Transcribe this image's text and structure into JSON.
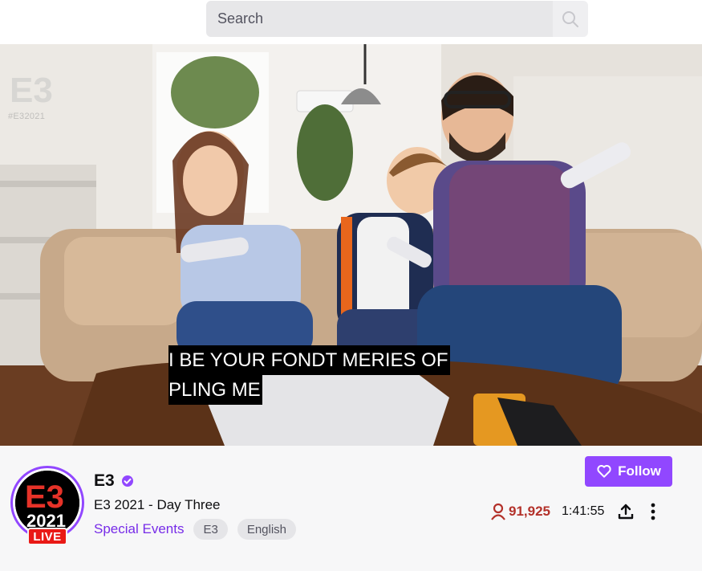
{
  "search": {
    "placeholder": "Search"
  },
  "video": {
    "watermark_tag": "#E32021",
    "caption_lines": [
      "I BE YOUR FONDT MERIES OF",
      "PLING ME"
    ]
  },
  "channel": {
    "name": "E3",
    "stream_title": "E3 2021 - Day Three",
    "category": "Special Events",
    "tags": [
      "E3",
      "English"
    ],
    "live_badge": "LIVE",
    "avatar_top": "E3",
    "avatar_year": "2021"
  },
  "actions": {
    "follow_label": "Follow"
  },
  "stats": {
    "viewers": "91,925",
    "uptime": "1:41:55"
  },
  "colors": {
    "accent": "#9147ff",
    "live": "#e91916",
    "viewer": "#b3312a",
    "category_link": "#772ce8"
  },
  "icons": {
    "search": "search-icon",
    "verified": "verified-badge-icon",
    "follow": "heart-icon",
    "viewers": "person-icon",
    "share": "share-upload-icon",
    "more": "more-vertical-icon"
  }
}
